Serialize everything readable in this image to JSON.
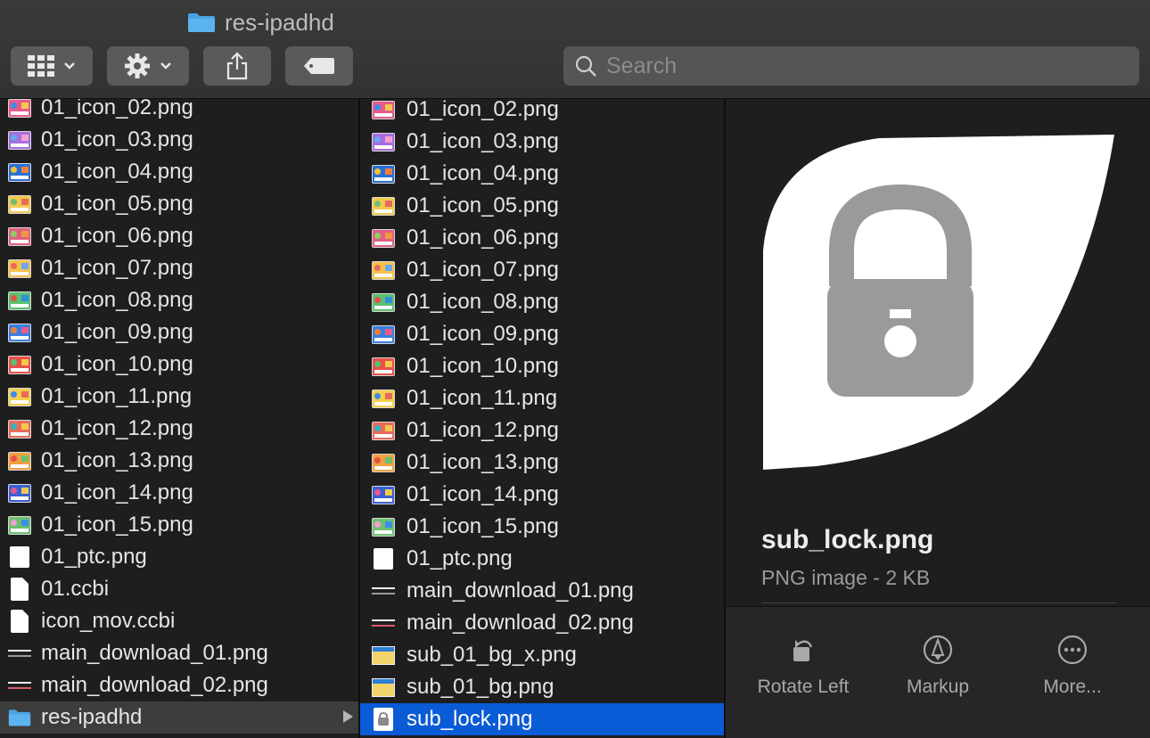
{
  "window": {
    "title": "res-ipadhd"
  },
  "toolbar": {
    "view_icon": "grid-view-icon",
    "action_icon": "gear-icon",
    "share_icon": "share-icon",
    "tag_icon": "tag-icon"
  },
  "search": {
    "placeholder": "Search",
    "value": ""
  },
  "column1": {
    "items": [
      {
        "label": "01_icon_02.png",
        "kind": "thumb"
      },
      {
        "label": "01_icon_03.png",
        "kind": "thumb"
      },
      {
        "label": "01_icon_04.png",
        "kind": "thumb"
      },
      {
        "label": "01_icon_05.png",
        "kind": "thumb"
      },
      {
        "label": "01_icon_06.png",
        "kind": "thumb"
      },
      {
        "label": "01_icon_07.png",
        "kind": "thumb"
      },
      {
        "label": "01_icon_08.png",
        "kind": "thumb"
      },
      {
        "label": "01_icon_09.png",
        "kind": "thumb"
      },
      {
        "label": "01_icon_10.png",
        "kind": "thumb"
      },
      {
        "label": "01_icon_11.png",
        "kind": "thumb"
      },
      {
        "label": "01_icon_12.png",
        "kind": "thumb"
      },
      {
        "label": "01_icon_13.png",
        "kind": "thumb"
      },
      {
        "label": "01_icon_14.png",
        "kind": "thumb"
      },
      {
        "label": "01_icon_15.png",
        "kind": "thumb"
      },
      {
        "label": "01_ptc.png",
        "kind": "blank"
      },
      {
        "label": "01.ccbi",
        "kind": "doc"
      },
      {
        "label": "icon_mov.ccbi",
        "kind": "doc"
      },
      {
        "label": "main_download_01.png",
        "kind": "line"
      },
      {
        "label": "main_download_02.png",
        "kind": "line-red"
      },
      {
        "label": "res-ipadhd",
        "kind": "folder",
        "selected": true
      }
    ]
  },
  "column2": {
    "items": [
      {
        "label": "01_icon_02.png",
        "kind": "thumb"
      },
      {
        "label": "01_icon_03.png",
        "kind": "thumb"
      },
      {
        "label": "01_icon_04.png",
        "kind": "thumb"
      },
      {
        "label": "01_icon_05.png",
        "kind": "thumb"
      },
      {
        "label": "01_icon_06.png",
        "kind": "thumb"
      },
      {
        "label": "01_icon_07.png",
        "kind": "thumb"
      },
      {
        "label": "01_icon_08.png",
        "kind": "thumb"
      },
      {
        "label": "01_icon_09.png",
        "kind": "thumb"
      },
      {
        "label": "01_icon_10.png",
        "kind": "thumb"
      },
      {
        "label": "01_icon_11.png",
        "kind": "thumb"
      },
      {
        "label": "01_icon_12.png",
        "kind": "thumb"
      },
      {
        "label": "01_icon_13.png",
        "kind": "thumb"
      },
      {
        "label": "01_icon_14.png",
        "kind": "thumb"
      },
      {
        "label": "01_icon_15.png",
        "kind": "thumb"
      },
      {
        "label": "01_ptc.png",
        "kind": "blank"
      },
      {
        "label": "main_download_01.png",
        "kind": "line"
      },
      {
        "label": "main_download_02.png",
        "kind": "line-red"
      },
      {
        "label": "sub_01_bg_x.png",
        "kind": "bg"
      },
      {
        "label": "sub_01_bg.png",
        "kind": "bg"
      },
      {
        "label": "sub_lock.png",
        "kind": "lock",
        "selected": true
      }
    ]
  },
  "preview": {
    "file_name": "sub_lock.png",
    "file_info": "PNG image - 2 KB",
    "actions": [
      {
        "label": "Rotate Left",
        "icon": "rotate-left-icon"
      },
      {
        "label": "Markup",
        "icon": "markup-icon"
      },
      {
        "label": "More...",
        "icon": "more-icon"
      }
    ]
  },
  "colors": {
    "selection_blue": "#0a5bd6",
    "selection_gray": "#3d3d3d",
    "folder_blue": "#4aa3e0",
    "lock_gray": "#9a9a9a"
  }
}
